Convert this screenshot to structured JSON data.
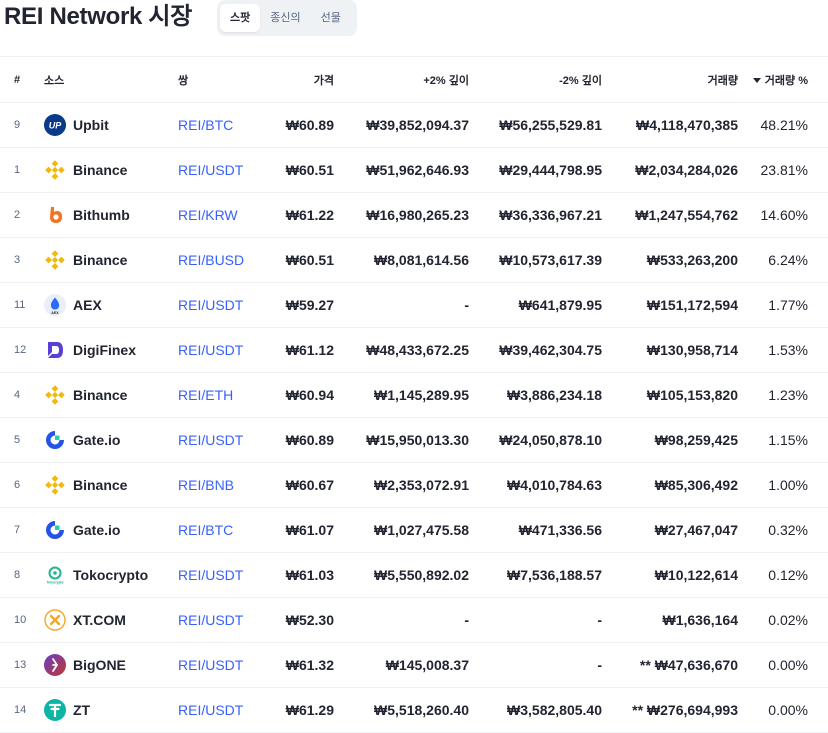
{
  "page": {
    "title": "REI Network 시장"
  },
  "tabs": [
    {
      "label": "스팟",
      "active": true
    },
    {
      "label": "종신의",
      "active": false
    },
    {
      "label": "선물",
      "active": false
    }
  ],
  "table": {
    "headers": {
      "rank": "#",
      "source": "소스",
      "pair": "쌍",
      "price": "가격",
      "plus_depth": "+2% 깊이",
      "minus_depth": "-2% 깊이",
      "volume": "거래량",
      "volume_pct": "거래량 %"
    },
    "rows": [
      {
        "rank": "9",
        "exchange": "Upbit",
        "icon": "upbit-logo-icon",
        "pair": "REI/BTC",
        "price": "₩60.89",
        "plus": "₩39,852,094.37",
        "minus": "₩56,255,529.81",
        "volume": "₩4,118,470,385",
        "pct": "48.21%"
      },
      {
        "rank": "1",
        "exchange": "Binance",
        "icon": "binance-logo-icon",
        "pair": "REI/USDT",
        "price": "₩60.51",
        "plus": "₩51,962,646.93",
        "minus": "₩29,444,798.95",
        "volume": "₩2,034,284,026",
        "pct": "23.81%"
      },
      {
        "rank": "2",
        "exchange": "Bithumb",
        "icon": "bithumb-logo-icon",
        "pair": "REI/KRW",
        "price": "₩61.22",
        "plus": "₩16,980,265.23",
        "minus": "₩36,336,967.21",
        "volume": "₩1,247,554,762",
        "pct": "14.60%"
      },
      {
        "rank": "3",
        "exchange": "Binance",
        "icon": "binance-logo-icon",
        "pair": "REI/BUSD",
        "price": "₩60.51",
        "plus": "₩8,081,614.56",
        "minus": "₩10,573,617.39",
        "volume": "₩533,263,200",
        "pct": "6.24%"
      },
      {
        "rank": "11",
        "exchange": "AEX",
        "icon": "aex-logo-icon",
        "pair": "REI/USDT",
        "price": "₩59.27",
        "plus": "-",
        "minus": "₩641,879.95",
        "volume": "₩151,172,594",
        "pct": "1.77%"
      },
      {
        "rank": "12",
        "exchange": "DigiFinex",
        "icon": "digifinex-logo-icon",
        "pair": "REI/USDT",
        "price": "₩61.12",
        "plus": "₩48,433,672.25",
        "minus": "₩39,462,304.75",
        "volume": "₩130,958,714",
        "pct": "1.53%"
      },
      {
        "rank": "4",
        "exchange": "Binance",
        "icon": "binance-logo-icon",
        "pair": "REI/ETH",
        "price": "₩60.94",
        "plus": "₩1,145,289.95",
        "minus": "₩3,886,234.18",
        "volume": "₩105,153,820",
        "pct": "1.23%"
      },
      {
        "rank": "5",
        "exchange": "Gate.io",
        "icon": "gateio-logo-icon",
        "pair": "REI/USDT",
        "price": "₩60.89",
        "plus": "₩15,950,013.30",
        "minus": "₩24,050,878.10",
        "volume": "₩98,259,425",
        "pct": "1.15%"
      },
      {
        "rank": "6",
        "exchange": "Binance",
        "icon": "binance-logo-icon",
        "pair": "REI/BNB",
        "price": "₩60.67",
        "plus": "₩2,353,072.91",
        "minus": "₩4,010,784.63",
        "volume": "₩85,306,492",
        "pct": "1.00%"
      },
      {
        "rank": "7",
        "exchange": "Gate.io",
        "icon": "gateio-logo-icon",
        "pair": "REI/BTC",
        "price": "₩61.07",
        "plus": "₩1,027,475.58",
        "minus": "₩471,336.56",
        "volume": "₩27,467,047",
        "pct": "0.32%"
      },
      {
        "rank": "8",
        "exchange": "Tokocrypto",
        "icon": "tokocrypto-logo-icon",
        "pair": "REI/USDT",
        "price": "₩61.03",
        "plus": "₩5,550,892.02",
        "minus": "₩7,536,188.57",
        "volume": "₩10,122,614",
        "pct": "0.12%"
      },
      {
        "rank": "10",
        "exchange": "XT.COM",
        "icon": "xtcom-logo-icon",
        "pair": "REI/USDT",
        "price": "₩52.30",
        "plus": "-",
        "minus": "-",
        "volume": "₩1,636,164",
        "pct": "0.02%"
      },
      {
        "rank": "13",
        "exchange": "BigONE",
        "icon": "bigone-logo-icon",
        "pair": "REI/USDT",
        "price": "₩61.32",
        "plus": "₩145,008.37",
        "minus": "-",
        "volume": "** ₩47,636,670",
        "pct": "0.00%"
      },
      {
        "rank": "14",
        "exchange": "ZT",
        "icon": "zt-logo-icon",
        "pair": "REI/USDT",
        "price": "₩61.29",
        "plus": "₩5,518,260.40",
        "minus": "₩3,582,805.40",
        "volume": "** ₩276,694,993",
        "pct": "0.00%"
      }
    ]
  },
  "logo_text": {
    "upbit": "UP",
    "aex": "AEX",
    "tokocrypto": "Tokocrypto"
  },
  "colors": {
    "accent_link": "#3861fb",
    "binance": "#f0b90b",
    "upbit": "#0a3a8a",
    "bithumb": "#f37321",
    "aex": "#2b6cf6",
    "digifinex": "#5a3fd6",
    "gateio": "#2354e6",
    "tokocrypto": "#1fb58f",
    "xtcom": "#f5a623",
    "bigone": "#c0392b",
    "zt": "#0bb5a4"
  }
}
